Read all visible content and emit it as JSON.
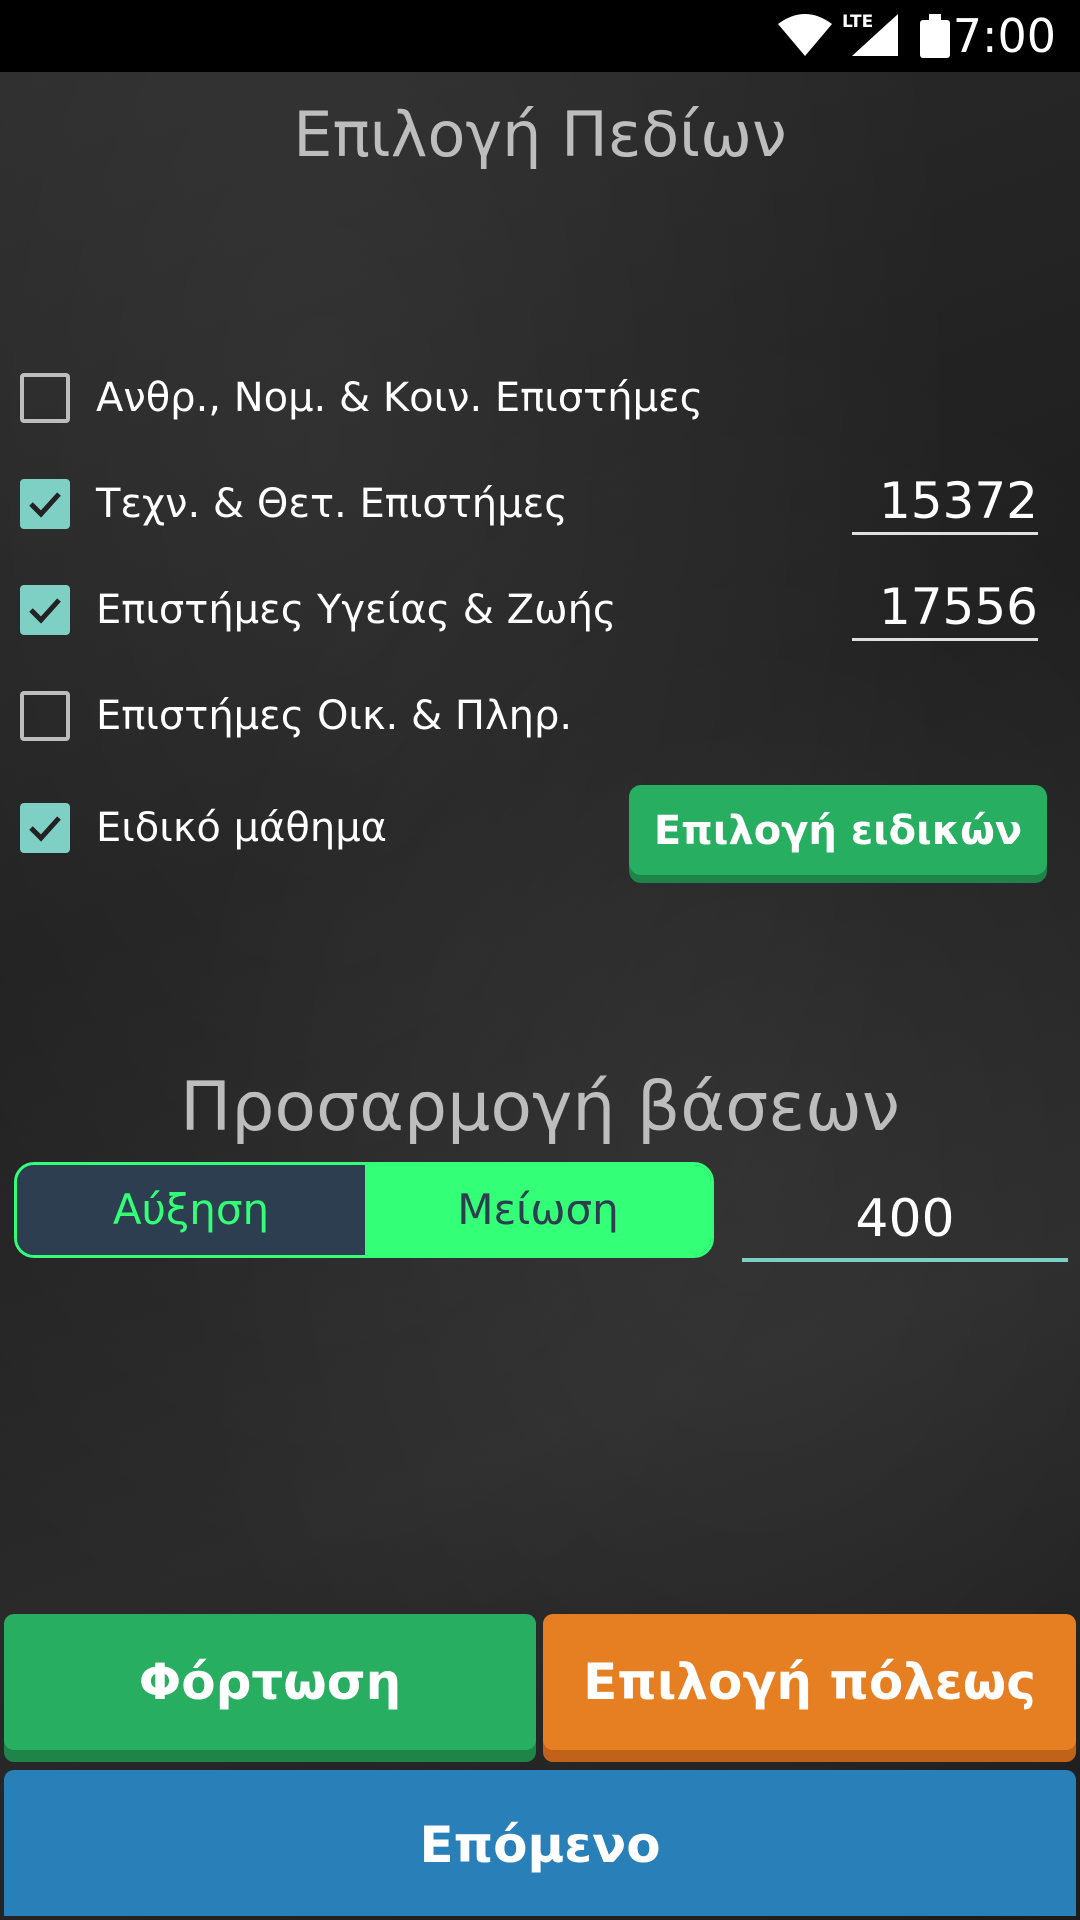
{
  "status_bar": {
    "time": "7:00",
    "network": "LTE"
  },
  "title": "Επιλογή Πεδίων",
  "fields": [
    {
      "label": "Ανθρ., Νομ. & Κοιν. Επιστήμες",
      "checked": false,
      "value": ""
    },
    {
      "label": "Τεχν. & Θετ. Επιστήμες",
      "checked": true,
      "value": "15372"
    },
    {
      "label": "Επιστήμες Υγείας & Ζωής",
      "checked": true,
      "value": "17556"
    },
    {
      "label": "Επιστήμες Οικ. & Πληρ.",
      "checked": false,
      "value": ""
    },
    {
      "label": "Ειδικό μάθημα",
      "checked": true,
      "value": ""
    }
  ],
  "special_button": "Επιλογή ειδικών",
  "adjust": {
    "title": "Προσαρμογή βάσεων",
    "increase": "Αύξηση",
    "decrease": "Μείωση",
    "selected": "decrease",
    "value": "400"
  },
  "buttons": {
    "load": "Φόρτωση",
    "city": "Επιλογή πόλεως",
    "next": "Επόμενο"
  },
  "colors": {
    "checkbox": "#7fd0c4",
    "green": "#27ae60",
    "orange": "#e67e22",
    "blue": "#2980b9",
    "toggle_active": "#33ff77",
    "toggle_dark": "#2c3e50"
  }
}
